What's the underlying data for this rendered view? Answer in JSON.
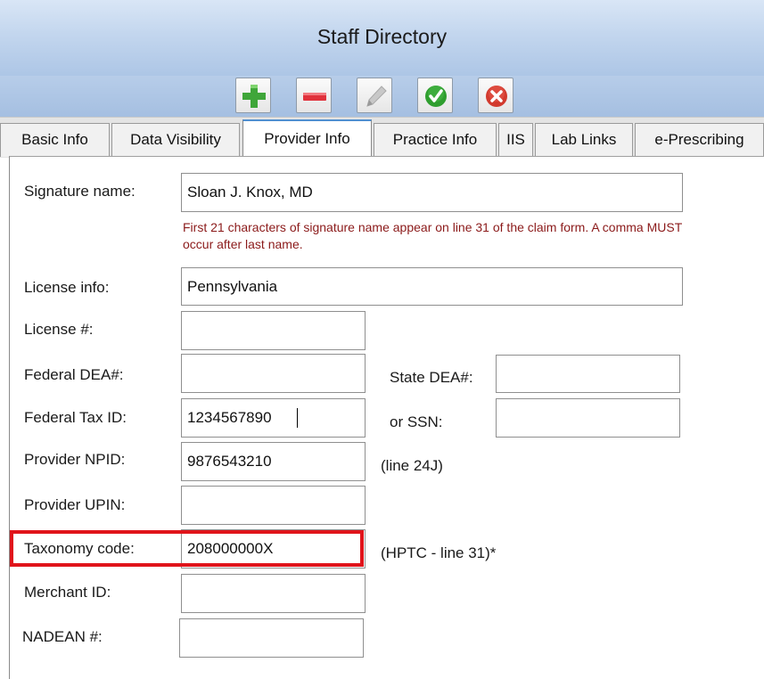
{
  "window": {
    "title": "Staff Directory"
  },
  "toolbar": {
    "buttons": [
      {
        "name": "add",
        "icon": "plus-icon",
        "color": "#3fa63a"
      },
      {
        "name": "delete",
        "icon": "minus-icon",
        "color": "#e0323c"
      },
      {
        "name": "edit",
        "icon": "pencil-icon",
        "color": "#b0b0b0"
      },
      {
        "name": "save",
        "icon": "check-icon",
        "color": "#2f9e2f"
      },
      {
        "name": "cancel",
        "icon": "x-icon",
        "color": "#d23a2e"
      }
    ]
  },
  "tabs": [
    {
      "label": "Basic Info"
    },
    {
      "label": "Data Visibility"
    },
    {
      "label": "Provider Info",
      "active": true
    },
    {
      "label": "Practice Info"
    },
    {
      "label": "IIS"
    },
    {
      "label": "Lab Links"
    },
    {
      "label": "e-Prescribing"
    }
  ],
  "form": {
    "signature_name": {
      "label": "Signature name:",
      "value": "Sloan J. Knox, MD"
    },
    "signature_note": "First 21 characters of signature name appear on line 31 of the claim form.  A comma MUST occur after last name.",
    "license_info": {
      "label": "License info:",
      "value": "Pennsylvania"
    },
    "license_number": {
      "label": "License #:",
      "value": ""
    },
    "federal_dea": {
      "label": "Federal DEA#:",
      "value": ""
    },
    "state_dea": {
      "label": "State DEA#:",
      "value": ""
    },
    "federal_tax_id": {
      "label": "Federal Tax ID:",
      "value": "1234567890"
    },
    "ssn": {
      "label": "or SSN:",
      "value": ""
    },
    "provider_npid": {
      "label": "Provider NPID:",
      "value": "9876543210",
      "hint": "(line 24J)"
    },
    "provider_upin": {
      "label": "Provider UPIN:",
      "value": ""
    },
    "taxonomy_code": {
      "label": "Taxonomy code:",
      "value": "208000000X",
      "hint": "(HPTC - line 31)*"
    },
    "merchant_id": {
      "label": "Merchant ID:",
      "value": ""
    },
    "nadean": {
      "label": "NADEAN #:",
      "value": ""
    }
  },
  "colors": {
    "highlight": "#e0141b",
    "note_text": "#8b1a1a",
    "active_tab_accent": "#4f8fd0"
  }
}
